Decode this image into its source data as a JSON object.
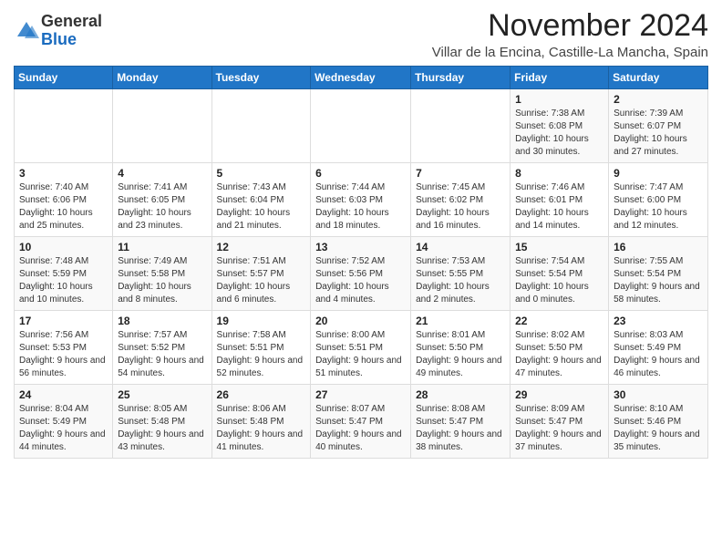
{
  "header": {
    "logo_line1": "General",
    "logo_line2": "Blue",
    "month_title": "November 2024",
    "location": "Villar de la Encina, Castille-La Mancha, Spain"
  },
  "weekdays": [
    "Sunday",
    "Monday",
    "Tuesday",
    "Wednesday",
    "Thursday",
    "Friday",
    "Saturday"
  ],
  "weeks": [
    [
      {
        "day": "",
        "info": ""
      },
      {
        "day": "",
        "info": ""
      },
      {
        "day": "",
        "info": ""
      },
      {
        "day": "",
        "info": ""
      },
      {
        "day": "",
        "info": ""
      },
      {
        "day": "1",
        "info": "Sunrise: 7:38 AM\nSunset: 6:08 PM\nDaylight: 10 hours and 30 minutes."
      },
      {
        "day": "2",
        "info": "Sunrise: 7:39 AM\nSunset: 6:07 PM\nDaylight: 10 hours and 27 minutes."
      }
    ],
    [
      {
        "day": "3",
        "info": "Sunrise: 7:40 AM\nSunset: 6:06 PM\nDaylight: 10 hours and 25 minutes."
      },
      {
        "day": "4",
        "info": "Sunrise: 7:41 AM\nSunset: 6:05 PM\nDaylight: 10 hours and 23 minutes."
      },
      {
        "day": "5",
        "info": "Sunrise: 7:43 AM\nSunset: 6:04 PM\nDaylight: 10 hours and 21 minutes."
      },
      {
        "day": "6",
        "info": "Sunrise: 7:44 AM\nSunset: 6:03 PM\nDaylight: 10 hours and 18 minutes."
      },
      {
        "day": "7",
        "info": "Sunrise: 7:45 AM\nSunset: 6:02 PM\nDaylight: 10 hours and 16 minutes."
      },
      {
        "day": "8",
        "info": "Sunrise: 7:46 AM\nSunset: 6:01 PM\nDaylight: 10 hours and 14 minutes."
      },
      {
        "day": "9",
        "info": "Sunrise: 7:47 AM\nSunset: 6:00 PM\nDaylight: 10 hours and 12 minutes."
      }
    ],
    [
      {
        "day": "10",
        "info": "Sunrise: 7:48 AM\nSunset: 5:59 PM\nDaylight: 10 hours and 10 minutes."
      },
      {
        "day": "11",
        "info": "Sunrise: 7:49 AM\nSunset: 5:58 PM\nDaylight: 10 hours and 8 minutes."
      },
      {
        "day": "12",
        "info": "Sunrise: 7:51 AM\nSunset: 5:57 PM\nDaylight: 10 hours and 6 minutes."
      },
      {
        "day": "13",
        "info": "Sunrise: 7:52 AM\nSunset: 5:56 PM\nDaylight: 10 hours and 4 minutes."
      },
      {
        "day": "14",
        "info": "Sunrise: 7:53 AM\nSunset: 5:55 PM\nDaylight: 10 hours and 2 minutes."
      },
      {
        "day": "15",
        "info": "Sunrise: 7:54 AM\nSunset: 5:54 PM\nDaylight: 10 hours and 0 minutes."
      },
      {
        "day": "16",
        "info": "Sunrise: 7:55 AM\nSunset: 5:54 PM\nDaylight: 9 hours and 58 minutes."
      }
    ],
    [
      {
        "day": "17",
        "info": "Sunrise: 7:56 AM\nSunset: 5:53 PM\nDaylight: 9 hours and 56 minutes."
      },
      {
        "day": "18",
        "info": "Sunrise: 7:57 AM\nSunset: 5:52 PM\nDaylight: 9 hours and 54 minutes."
      },
      {
        "day": "19",
        "info": "Sunrise: 7:58 AM\nSunset: 5:51 PM\nDaylight: 9 hours and 52 minutes."
      },
      {
        "day": "20",
        "info": "Sunrise: 8:00 AM\nSunset: 5:51 PM\nDaylight: 9 hours and 51 minutes."
      },
      {
        "day": "21",
        "info": "Sunrise: 8:01 AM\nSunset: 5:50 PM\nDaylight: 9 hours and 49 minutes."
      },
      {
        "day": "22",
        "info": "Sunrise: 8:02 AM\nSunset: 5:50 PM\nDaylight: 9 hours and 47 minutes."
      },
      {
        "day": "23",
        "info": "Sunrise: 8:03 AM\nSunset: 5:49 PM\nDaylight: 9 hours and 46 minutes."
      }
    ],
    [
      {
        "day": "24",
        "info": "Sunrise: 8:04 AM\nSunset: 5:49 PM\nDaylight: 9 hours and 44 minutes."
      },
      {
        "day": "25",
        "info": "Sunrise: 8:05 AM\nSunset: 5:48 PM\nDaylight: 9 hours and 43 minutes."
      },
      {
        "day": "26",
        "info": "Sunrise: 8:06 AM\nSunset: 5:48 PM\nDaylight: 9 hours and 41 minutes."
      },
      {
        "day": "27",
        "info": "Sunrise: 8:07 AM\nSunset: 5:47 PM\nDaylight: 9 hours and 40 minutes."
      },
      {
        "day": "28",
        "info": "Sunrise: 8:08 AM\nSunset: 5:47 PM\nDaylight: 9 hours and 38 minutes."
      },
      {
        "day": "29",
        "info": "Sunrise: 8:09 AM\nSunset: 5:47 PM\nDaylight: 9 hours and 37 minutes."
      },
      {
        "day": "30",
        "info": "Sunrise: 8:10 AM\nSunset: 5:46 PM\nDaylight: 9 hours and 35 minutes."
      }
    ]
  ]
}
